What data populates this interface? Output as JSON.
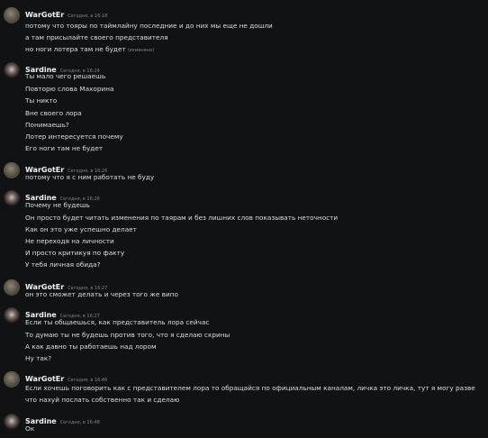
{
  "users": {
    "wargoter": "WarGotEr",
    "sardine": "Sardine"
  },
  "groups": [
    {
      "author": "WarGotEr",
      "timestamp": "Сегодня, в 16:18",
      "messages": [
        "потому что тояры по таймлайну последние и до них мы еще не дошли",
        "а там присылайте своего представителя",
        "но ноги лотера там не будет"
      ],
      "edited_label": "(изменено)"
    },
    {
      "author": "Sardine",
      "timestamp": "Сегодня, в 16:24",
      "messages": [
        "Ты мало чего решаешь",
        "Повторю слова Махорина",
        "Ты никто",
        "Вне своего лора",
        "Понимаешь?",
        "Лотер интересуется почему",
        "Его ноги там не будет"
      ]
    },
    {
      "author": "WarGotEr",
      "timestamp": "Сегодня, в 16:26",
      "messages": [
        "потому что я с ним работать не буду"
      ]
    },
    {
      "author": "Sardine",
      "timestamp": "Сегодня, в 16:26",
      "messages": [
        "Почему не будешь",
        "Он просто будет читать изменения по таярам и без лишних слов показывать неточности",
        "Как он это уже успешно делает",
        "Не переходя на личности",
        "И просто критикуя по факту",
        "У тебя личная обида?"
      ]
    },
    {
      "author": "WarGotEr",
      "timestamp": "Сегодня, в 16:27",
      "messages": [
        "он это сможет делать и через того же випо"
      ]
    },
    {
      "author": "Sardine",
      "timestamp": "Сегодня, в 16:27",
      "messages": [
        "Если ты общаешься, как представитель лора сейчас",
        "То думаю ты не будешь против того, что я сделаю скрины",
        "А как давно ты работаешь над лором",
        "Ну так?"
      ]
    },
    {
      "author": "WarGotEr",
      "timestamp": "Сегодня, в 16:46",
      "messages": [
        "Если хочешь поговорить как с представителем лора то обращайся по официальным каналам, личка это личка, тут я могу разве что нахуй послать собственно так и сделаю"
      ]
    },
    {
      "author": "Sardine",
      "timestamp": "Сегодня, в 16:48",
      "messages": [
        "Ок"
      ]
    }
  ]
}
